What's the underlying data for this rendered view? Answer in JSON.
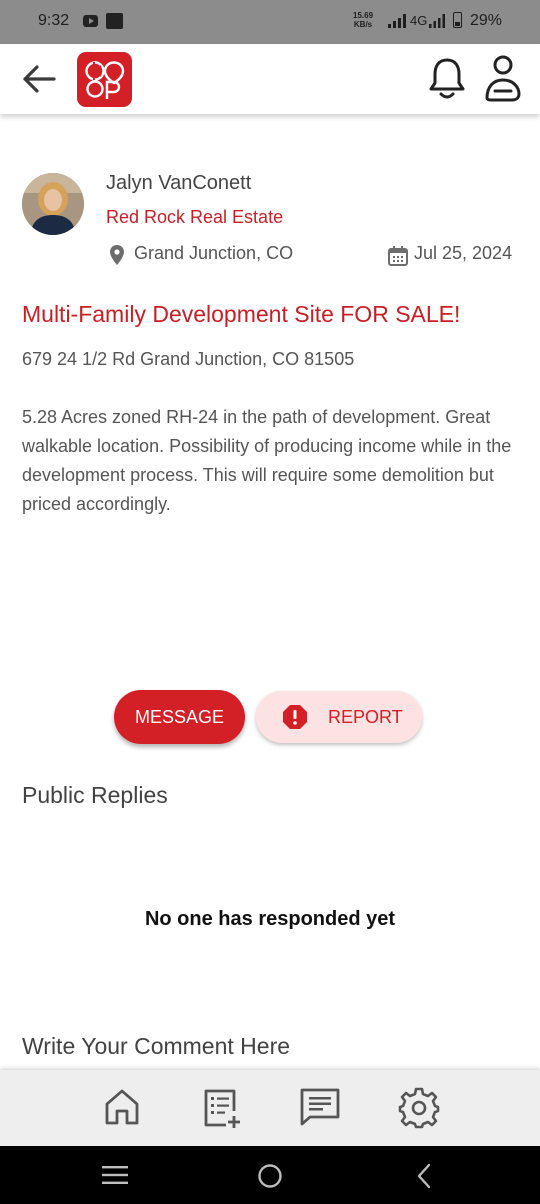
{
  "status_bar": {
    "time": "9:32",
    "speed_value": "15.69",
    "speed_unit": "KB/s",
    "network": "4G",
    "battery": "29%"
  },
  "header": {
    "logo_text": "CO OP",
    "icons": [
      "back-arrow-icon",
      "bell-icon",
      "user-icon"
    ]
  },
  "post": {
    "author_name": "Jalyn VanConett",
    "agency": "Red Rock Real Estate",
    "location": "Grand Junction, CO",
    "date": "Jul 25, 2024",
    "title": "Multi-Family Development Site FOR SALE!",
    "address": "679 24 1/2 Rd Grand Junction, CO  81505",
    "description": "5.28 Acres zoned RH-24 in the path of development.  Great walkable location.  Possibility of producing income while in the development process.  This will require some demolition but priced accordingly."
  },
  "actions": {
    "message_label": "MESSAGE",
    "report_label": "REPORT"
  },
  "replies": {
    "heading": "Public Replies",
    "empty_text": "No one has responded yet"
  },
  "comment": {
    "heading": "Write Your Comment Here"
  },
  "bottom_nav": [
    "home-icon",
    "add-listing-icon",
    "messages-icon",
    "settings-icon"
  ],
  "colors": {
    "brand_red": "#d31f26",
    "report_bg": "#fde2e3",
    "statusbar_bg": "#8c8c8c",
    "nav_bg": "#eeeeee"
  }
}
